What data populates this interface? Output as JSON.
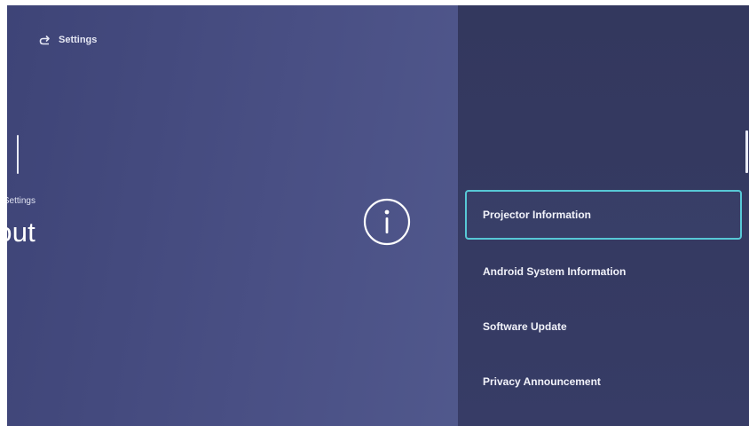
{
  "header": {
    "back_label": "Settings",
    "back_icon": "back-arrow-icon"
  },
  "main": {
    "section_label": "Settings",
    "title": "About",
    "icon": "info-icon"
  },
  "menu": {
    "items": [
      {
        "label": "Projector Information",
        "selected": true
      },
      {
        "label": "Android System Information",
        "selected": false
      },
      {
        "label": "Software Update",
        "selected": false
      },
      {
        "label": "Privacy Announcement",
        "selected": false
      }
    ]
  },
  "colors": {
    "left_background": "#4a5085",
    "right_background": "#353a62",
    "focus_border": "#57c8d6",
    "text": "#ffffff"
  }
}
